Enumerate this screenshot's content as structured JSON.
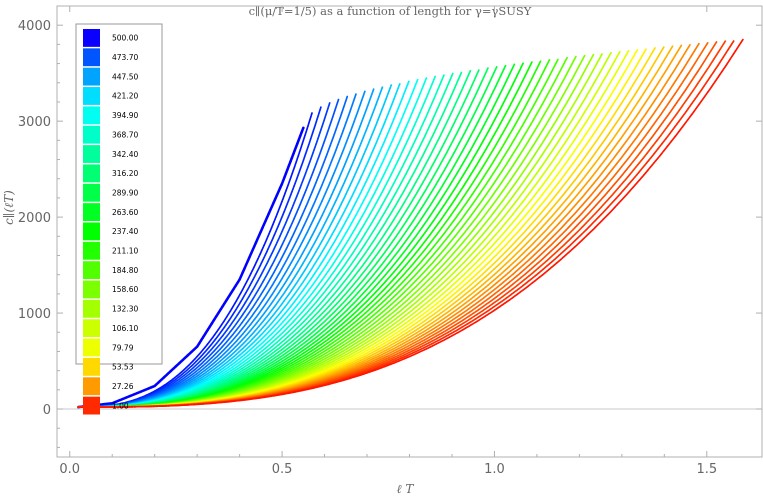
{
  "chart_data": {
    "type": "line",
    "title": "c∥(μ/T=1/5) as a function of length for γ=γSUSY",
    "xlabel": "ℓ T",
    "ylabel": "c∥(ℓT)",
    "xlim": [
      -0.03,
      1.63
    ],
    "ylim": [
      -500,
      4200
    ],
    "x_ticks": [
      0.0,
      0.5,
      1.0,
      1.5
    ],
    "x_tick_labels": [
      "0.0",
      "0.5",
      "1.0",
      "1.5"
    ],
    "y_ticks": [
      0,
      1000,
      2000,
      3000,
      4000
    ],
    "y_tick_labels": [
      "0",
      "1000",
      "2000",
      "3000",
      "4000"
    ],
    "grid": false,
    "legend_position": "top-left",
    "colormap": "rainbow (blue = 500.00, red = 1.00)",
    "series_count": 51,
    "parameter_range": [
      1.0,
      500.0
    ],
    "envelope_front": {
      "x": [
        0.02,
        0.1,
        0.2,
        0.3,
        0.4,
        0.5,
        0.55
      ],
      "y": [
        20,
        60,
        240,
        650,
        1350,
        2350,
        2930
      ]
    },
    "series_endpoints": {
      "parameter": [
        500.0,
        1.0
      ],
      "x_end": [
        0.55,
        1.585
      ],
      "y_end": [
        2930,
        3850
      ]
    },
    "legend": {
      "entries": [
        {
          "label": "500.00",
          "color": "#0a00ff"
        },
        {
          "label": "473.70",
          "color": "#0055ff"
        },
        {
          "label": "447.50",
          "color": "#00a4ff"
        },
        {
          "label": "421.20",
          "color": "#00ddff"
        },
        {
          "label": "394.90",
          "color": "#00fff0"
        },
        {
          "label": "368.70",
          "color": "#00ffc8"
        },
        {
          "label": "342.40",
          "color": "#00ff9c"
        },
        {
          "label": "316.20",
          "color": "#00ff72"
        },
        {
          "label": "289.90",
          "color": "#00ff48"
        },
        {
          "label": "263.60",
          "color": "#00ff22"
        },
        {
          "label": "237.40",
          "color": "#00ff00"
        },
        {
          "label": "211.10",
          "color": "#22ff00"
        },
        {
          "label": "184.80",
          "color": "#52ff00"
        },
        {
          "label": "158.60",
          "color": "#7cff00"
        },
        {
          "label": "132.30",
          "color": "#a4ff00"
        },
        {
          "label": "106.10",
          "color": "#ccff00"
        },
        {
          "label": "79.79",
          "color": "#eeff00"
        },
        {
          "label": "53.53",
          "color": "#ffd800"
        },
        {
          "label": "27.26",
          "color": "#ff9a00"
        },
        {
          "label": "1.00",
          "color": "#ff2a00"
        }
      ]
    }
  }
}
